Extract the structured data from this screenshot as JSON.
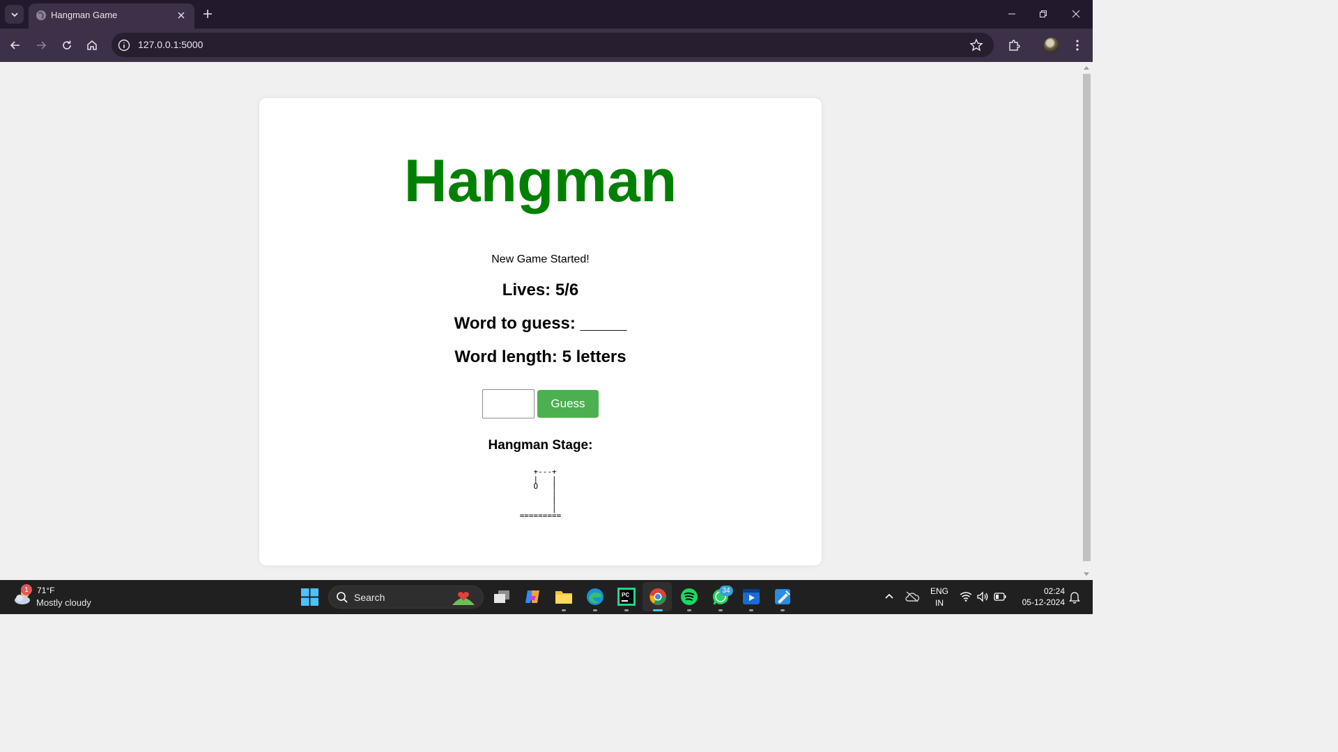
{
  "browser": {
    "tab": {
      "title": "Hangman Game"
    },
    "address": {
      "url": "127.0.0.1:5000"
    }
  },
  "page": {
    "title": "Hangman",
    "status": "New Game Started!",
    "lives": "Lives: 5/6",
    "word_to_guess": "Word to guess: _____",
    "word_length": "Word length: 5 letters",
    "guess_input": {
      "value": "",
      "placeholder": ""
    },
    "guess_button": "Guess",
    "stage_label": "Hangman Stage:",
    "stage_art": "  +---+\n  |   |\n  O   |\n      |\n      |\n      |\n=========",
    "title_color": "#008000",
    "button_color": "#4caf50"
  },
  "taskbar": {
    "weather": {
      "badge": "1",
      "temp": "71°F",
      "desc": "Mostly cloudy"
    },
    "search": {
      "label": "Search"
    },
    "whatsapp_badge": "34",
    "language": {
      "line1": "ENG",
      "line2": "IN"
    },
    "clock": {
      "time": "02:24",
      "date": "05-12-2024"
    }
  }
}
